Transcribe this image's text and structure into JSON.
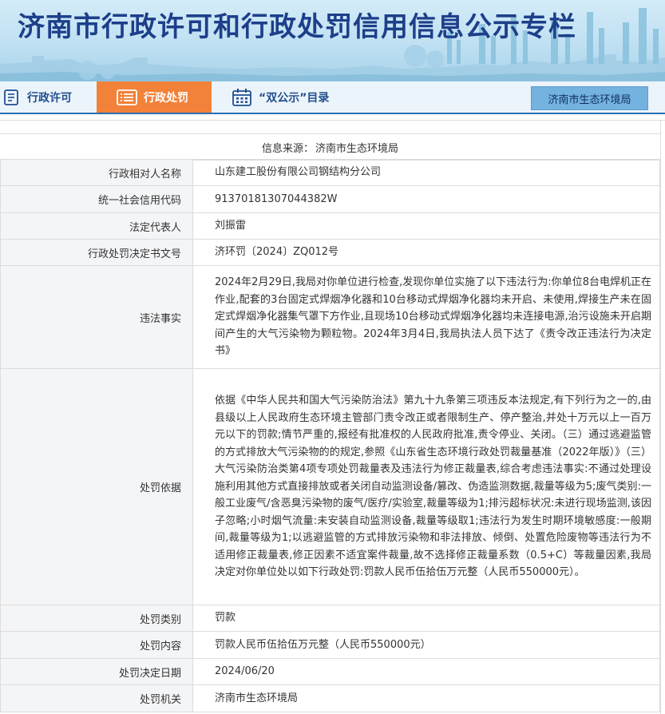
{
  "banner": {
    "title": "济南市行政许可和行政处罚信用信息公示专栏"
  },
  "nav": {
    "items": [
      {
        "label": "行政许可",
        "icon": "document-list-icon",
        "active": false
      },
      {
        "label": "行政处罚",
        "icon": "list-icon",
        "active": true
      },
      {
        "label": "“双公示”目录",
        "icon": "calendar-icon",
        "active": false
      }
    ],
    "department_button": "济南市生态环境局",
    "accent_color": "#f2823a",
    "title_color": "#1d3f8a"
  },
  "source": {
    "label": "信息来源：",
    "value": "济南市生态环境局"
  },
  "rows": [
    {
      "key": "行政相对人名称",
      "value": "山东建工股份有限公司钢结构分公司"
    },
    {
      "key": "统一社会信用代码",
      "value": "91370181307044382W"
    },
    {
      "key": "法定代表人",
      "value": "刘振雷"
    },
    {
      "key": "行政处罚决定书文号",
      "value": "济环罚〔2024〕ZQ012号"
    },
    {
      "key": "违法事实",
      "value": "2024年2月29日,我局对你单位进行检查,发现你单位实施了以下违法行为:你单位8台电焊机正在作业,配套的3台固定式焊烟净化器和10台移动式焊烟净化器均未开启、未使用,焊接生产未在固定式焊烟净化器集气罩下方作业,且现场10台移动式焊烟净化器均未连接电源,治污设施未开启期间产生的大气污染物为颗粒物。2024年3月4日,我局执法人员下达了《责令改正违法行为决定书》"
    },
    {
      "key": "处罚依据",
      "value": "依据《中华人民共和国大气污染防治法》第九十九条第三项违反本法规定,有下列行为之一的,由县级以上人民政府生态环境主管部门责令改正或者限制生产、停产整治,并处十万元以上一百万元以下的罚款;情节严重的,报经有批准权的人民政府批准,责令停业、关闭。（三）通过逃避监管的方式排放大气污染物的的规定,参照《山东省生态环境行政处罚裁量基准（2022年版）》（三）大气污染防治类第4项专项处罚裁量表及违法行为修正裁量表,综合考虑违法事实:不通过处理设施利用其他方式直接排放或者关闭自动监测设备/篡改、伪造监测数据,裁量等级为5;废气类别:一般工业废气/含恶臭污染物的废气/医疗/实验室,裁量等级为1;排污超标状况:未进行现场监测,该因子忽略;小时烟气流量:未安装自动监测设备,裁量等级取1;违法行为发生时期环境敏感度:一般期间,裁量等级为1;以逃避监管的方式排放污染物和非法排放、倾倒、处置危险废物等违法行为不适用修正裁量表,修正因素不适宜案件裁量,故不选择修正裁量系数（0.5+C）等裁量因素,我局决定对你单位处以如下行政处罚:罚款人民币伍拾伍万元整（人民币550000元）。"
    },
    {
      "key": "处罚类别",
      "value": "罚款"
    },
    {
      "key": "处罚内容",
      "value": "罚款人民币伍拾伍万元整（人民币550000元）"
    },
    {
      "key": "处罚决定日期",
      "value": "2024/06/20"
    },
    {
      "key": "处罚机关",
      "value": "济南市生态环境局"
    }
  ]
}
